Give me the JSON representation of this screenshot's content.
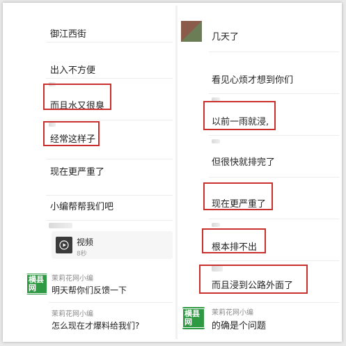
{
  "left_column": {
    "messages": [
      {
        "text": "御江西街"
      },
      {
        "text": "出入不方便"
      },
      {
        "text": "而且水又很臭"
      },
      {
        "text": "经常这样子"
      },
      {
        "text": "现在更严重了"
      },
      {
        "text": "小编帮帮我们吧"
      }
    ],
    "video": {
      "title": "视频",
      "duration": "8秒"
    },
    "replies": [
      {
        "name": "茉莉花网小编",
        "text": "明天帮你们反馈一下",
        "avatar_label": "横县网"
      },
      {
        "name": "茉莉花网小编",
        "text": "怎么现在才爆料给我们?"
      }
    ]
  },
  "right_column": {
    "messages": [
      {
        "text": "几天了"
      },
      {
        "text": "看见心烦才想到你们"
      },
      {
        "text": "以前一雨就浸,"
      },
      {
        "text": "但很快就排完了"
      },
      {
        "text": "现在更严重了"
      },
      {
        "text": "根本排不出"
      },
      {
        "text": "而且浸到公路外面了"
      }
    ],
    "reply": {
      "name": "茉莉花网小编",
      "text": "的确是个问题",
      "avatar_label": "横县网"
    }
  },
  "colors": {
    "highlight_border": "#c9302c",
    "logo_green": "#2f9a43"
  }
}
